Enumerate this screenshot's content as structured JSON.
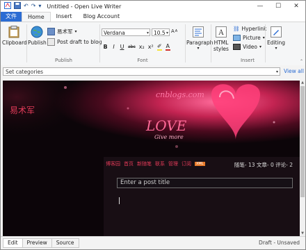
{
  "window": {
    "title": "Untitled - Open Live Writer",
    "controls": [
      "—",
      "☐",
      "✕"
    ]
  },
  "tabs": [
    "文件",
    "Home",
    "Insert",
    "Blog Account"
  ],
  "ribbon": {
    "clipboard": {
      "button": "Clipboard",
      "icon": "clipboard-icon"
    },
    "publish": {
      "group_label": "Publish",
      "publish_button": "Publish",
      "blog_selector": "易术军",
      "post_draft": "Post draft to blog"
    },
    "font": {
      "group_label": "Font",
      "family": "Verdana",
      "size": "10.5",
      "buttons": [
        "B",
        "I",
        "U",
        "abc",
        "x₂",
        "x²",
        "✐",
        "A"
      ]
    },
    "paragraph": {
      "button": "Paragraph"
    },
    "html_styles": {
      "button_line1": "HTML",
      "button_line2": "styles"
    },
    "insert": {
      "group_label": "Insert",
      "hyperlink": "Hyperlink",
      "picture": "Picture",
      "video": "Video"
    },
    "editing": {
      "button": "Editing"
    }
  },
  "categories": {
    "placeholder": "Set categories",
    "view_all": "View all"
  },
  "blog_preview": {
    "blog_name": "易术军",
    "nav": [
      "博客园",
      "首页",
      "新随笔",
      "联系",
      "管理",
      "订阅"
    ],
    "nav_badge": "XML",
    "stats": "随笔- 13  文章- 0  评论- 2",
    "title_placeholder": "Enter a post title"
  },
  "status_bar": {
    "view_tabs": [
      "Edit",
      "Preview",
      "Source"
    ],
    "active_view": "Edit",
    "status": "Draft - Unsaved"
  },
  "colors": {
    "accent": "#2b6cd3",
    "blog_red": "#e23b58"
  }
}
